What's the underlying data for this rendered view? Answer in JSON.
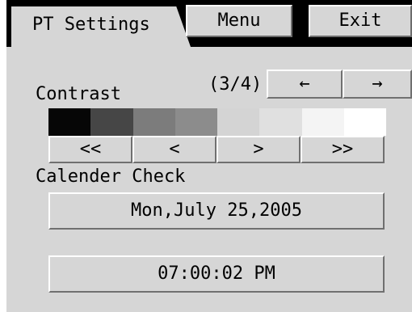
{
  "tabs": {
    "active": "PT Settings",
    "menu": "Menu",
    "exit": "Exit"
  },
  "pager": {
    "page": "(3/4)",
    "prev_arrow": "←",
    "next_arrow": "→"
  },
  "contrast": {
    "label": "Contrast",
    "swatches": [
      "#060606",
      "#464646",
      "#7c7c7c",
      "#8c8c8c",
      "#d4d4d4",
      "#e0e0e0",
      "#f4f4f4",
      "#ffffff"
    ],
    "buttons": [
      "<<",
      "<",
      ">",
      ">>"
    ]
  },
  "calendar": {
    "label": "Calender Check",
    "date": "Mon,July 25,2005",
    "time": "07:00:02 PM"
  }
}
